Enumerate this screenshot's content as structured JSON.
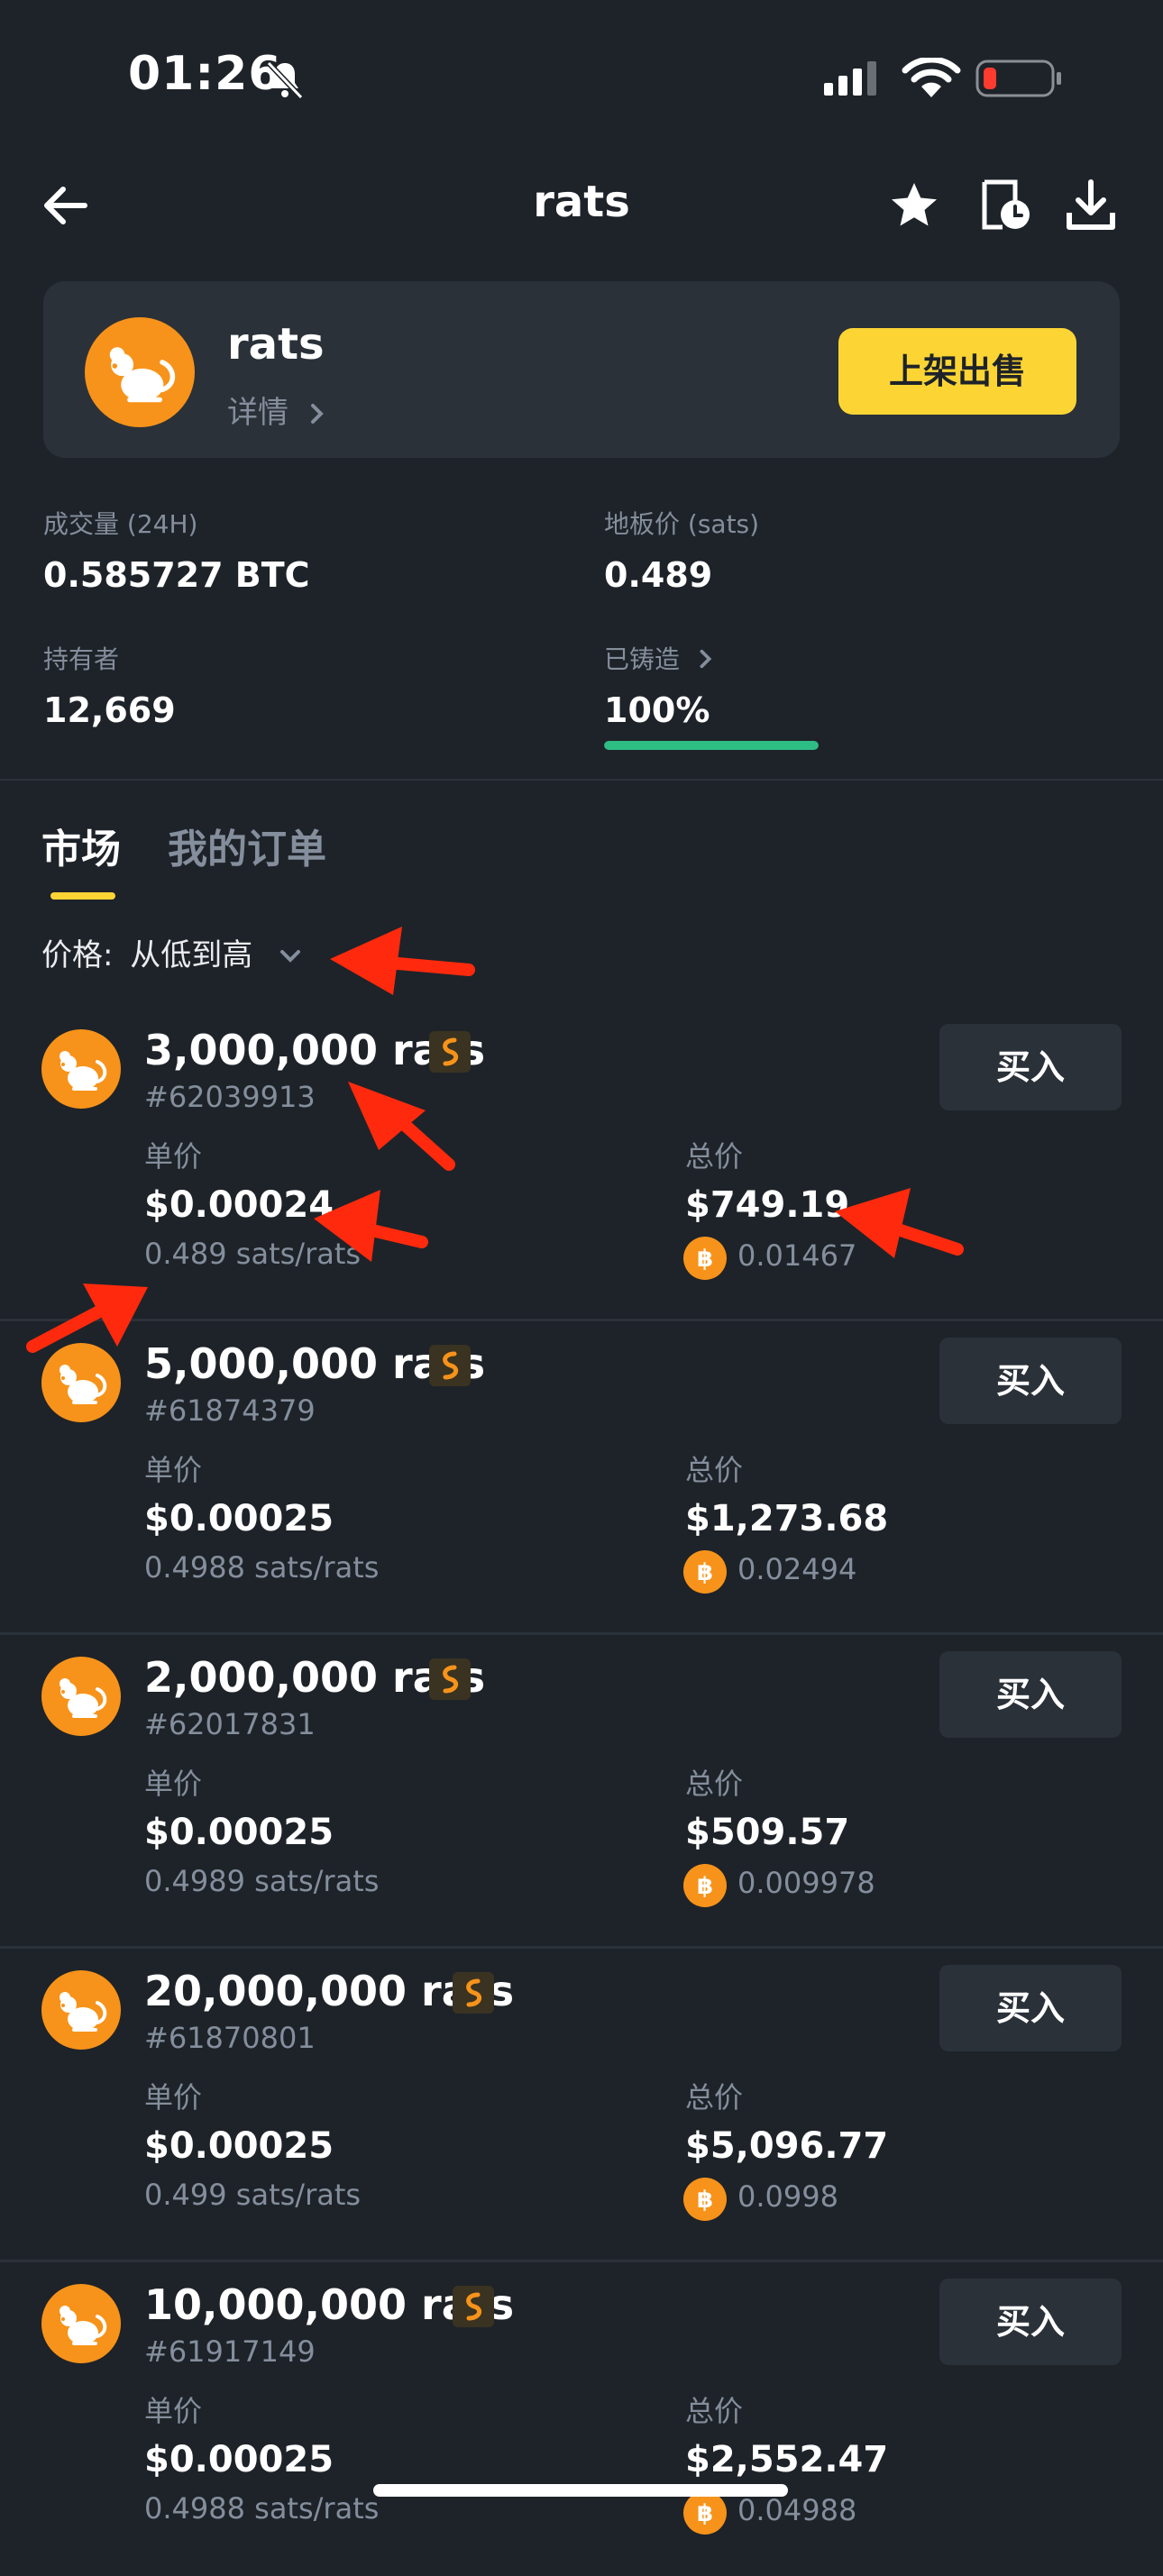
{
  "status_bar": {
    "time": "01:26"
  },
  "header": {
    "title": "rats"
  },
  "collection": {
    "name": "rats",
    "detail_label": "详情",
    "list_button": "上架出售"
  },
  "stats": {
    "volume_label": "成交量 (24H)",
    "volume_value": "0.585727 BTC",
    "floor_label": "地板价 (sats)",
    "floor_value": "0.489",
    "holders_label": "持有者",
    "holders_value": "12,669",
    "minted_label": "已铸造",
    "minted_value": "100%",
    "minted_progress": 1.0
  },
  "tabs": {
    "market": "市场",
    "my_orders": "我的订单"
  },
  "sort": {
    "label": "价格:",
    "value": "从低到高"
  },
  "listing_labels": {
    "unit_price": "单价",
    "total_price": "总价",
    "buy": "买入"
  },
  "listings": [
    {
      "title": "3,000,000 rats",
      "id": "#62039913",
      "unit_price": "$0.00024",
      "unit_sats": "0.489 sats/rats",
      "total_price": "$749.19",
      "btc": "0.01467"
    },
    {
      "title": "5,000,000 rats",
      "id": "#61874379",
      "unit_price": "$0.00025",
      "unit_sats": "0.4988 sats/rats",
      "total_price": "$1,273.68",
      "btc": "0.02494"
    },
    {
      "title": "2,000,000 rats",
      "id": "#62017831",
      "unit_price": "$0.00025",
      "unit_sats": "0.4989 sats/rats",
      "total_price": "$509.57",
      "btc": "0.009978"
    },
    {
      "title": "20,000,000 rats",
      "id": "#61870801",
      "unit_price": "$0.00025",
      "unit_sats": "0.499 sats/rats",
      "total_price": "$5,096.77",
      "btc": "0.0998"
    },
    {
      "title": "10,000,000 rats",
      "id": "#61917149",
      "unit_price": "$0.00025",
      "unit_sats": "0.4988 sats/rats",
      "total_price": "$2,552.47",
      "btc": "0.04988"
    }
  ],
  "colors": {
    "background": "#1e2329",
    "accent": "#fcd535",
    "progress": "#2ebd85",
    "rat_orange": "#f7931a",
    "annotation_arrow": "#ff2a0d"
  }
}
